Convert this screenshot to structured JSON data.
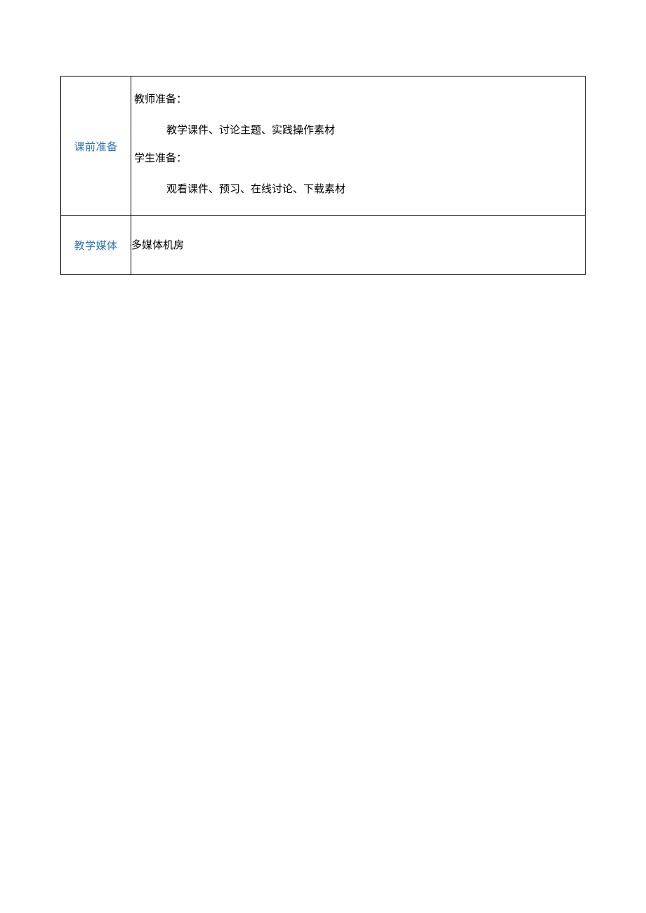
{
  "rows": {
    "prep": {
      "label": "课前准备",
      "teacher_heading": "教师准备：",
      "teacher_detail": "教学课件、讨论主题、实践操作素材",
      "student_heading": "学生准备：",
      "student_detail": "观看课件、预习、在线讨论、下载素材"
    },
    "media": {
      "label": "教学媒体",
      "value": "多媒体机房"
    }
  }
}
